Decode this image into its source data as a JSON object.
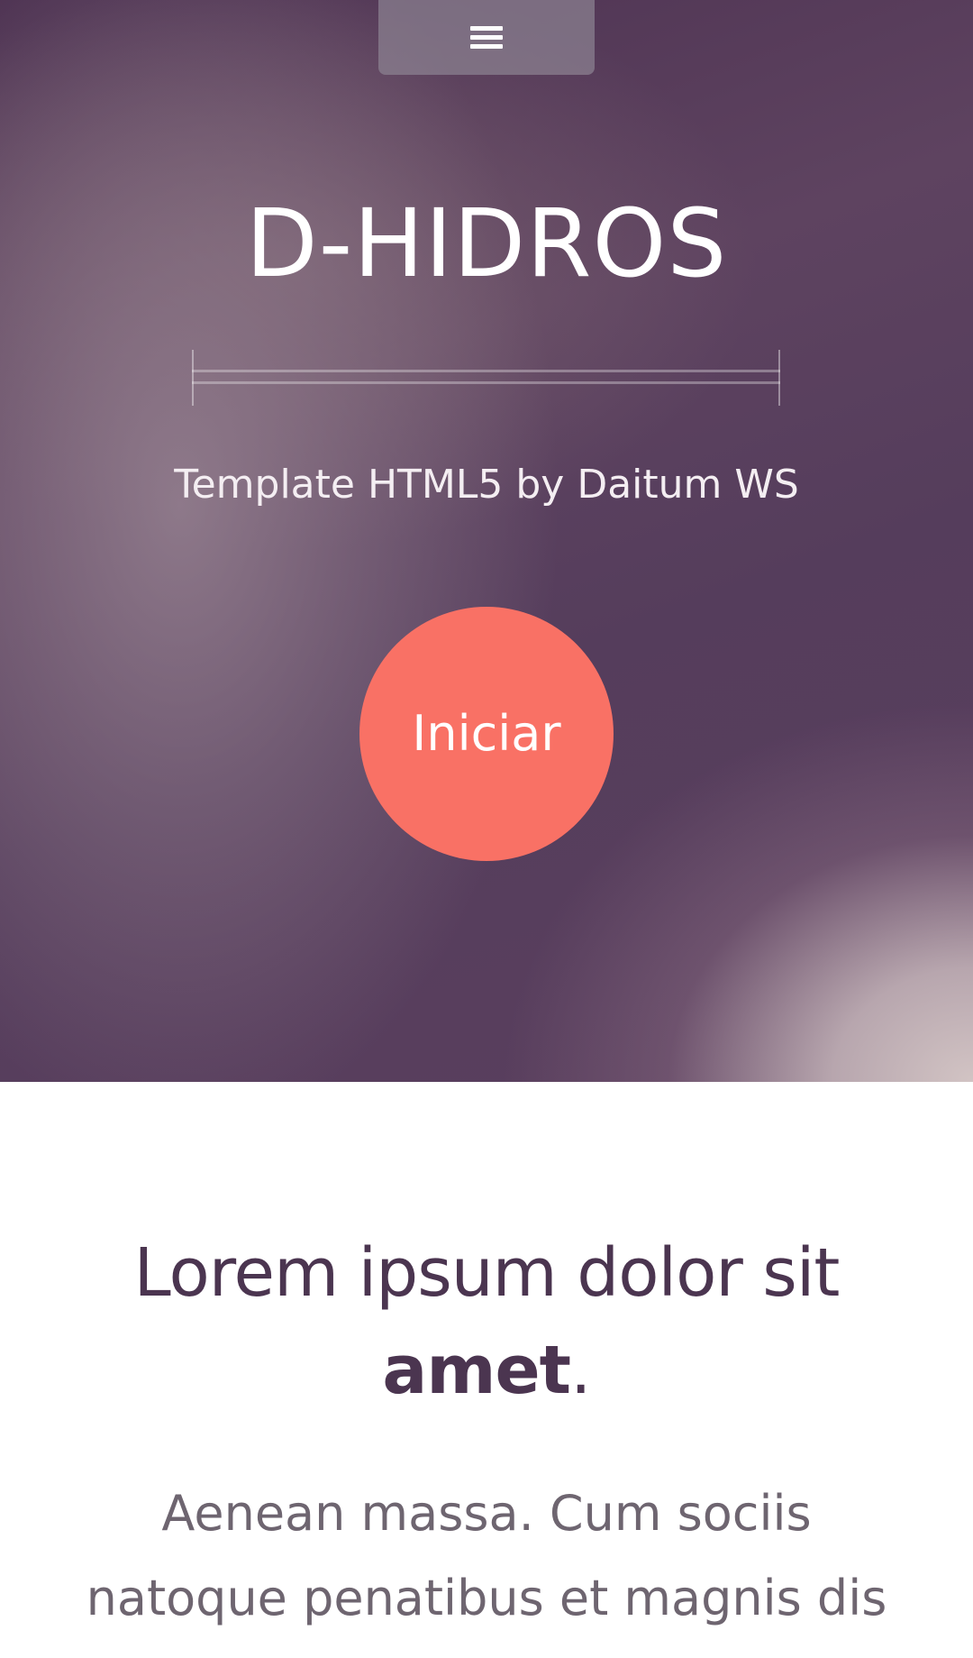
{
  "nav": {
    "menu_icon": "hamburger-icon"
  },
  "hero": {
    "title": "D-HIDROS",
    "subtitle": "Template HTML5 by Daitum WS",
    "cta_label": "Iniciar"
  },
  "section": {
    "heading_regular": "Lorem ipsum dolor sit",
    "heading_bold": "amet",
    "heading_end": ".",
    "paragraph": "Aenean massa. Cum sociis natoque penatibus et magnis dis"
  },
  "colors": {
    "hero_background": "#5b405f",
    "accent": "#f97165",
    "heading_text": "#4b3550",
    "body_text": "#6e6570"
  }
}
